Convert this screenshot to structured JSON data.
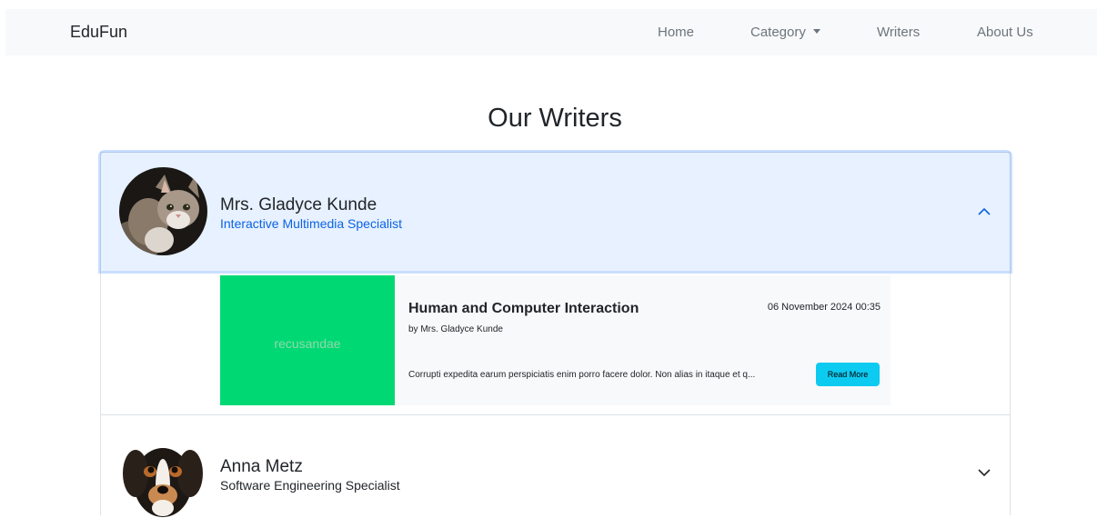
{
  "navbar": {
    "brand": "EduFun",
    "items": [
      {
        "label": "Home"
      },
      {
        "label": "Category"
      },
      {
        "label": "Writers"
      },
      {
        "label": "About Us"
      }
    ]
  },
  "page": {
    "title": "Our Writers"
  },
  "writers": [
    {
      "name": "Mrs. Gladyce Kunde",
      "role": "Interactive Multimedia Specialist",
      "expanded": true,
      "article": {
        "thumb_text": "recusandae",
        "title": "Human and Computer Interaction",
        "date": "06 November 2024 00:35",
        "author": "by Mrs. Gladyce Kunde",
        "excerpt": "Corrupti expedita earum perspiciatis enim porro facere dolor. Non alias in itaque et q...",
        "button": "Read More"
      }
    },
    {
      "name": "Anna Metz",
      "role": "Software Engineering Specialist",
      "expanded": false
    }
  ],
  "colors": {
    "accent": "#0c63e4",
    "header_bg_open": "#e7f1ff",
    "thumb_bg": "#00d973",
    "button_bg": "#0dcaf0"
  }
}
